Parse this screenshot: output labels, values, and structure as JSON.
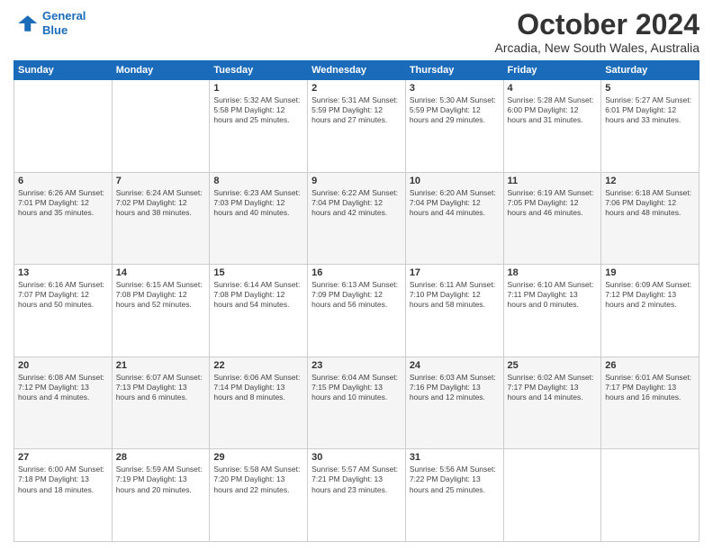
{
  "header": {
    "logo_line1": "General",
    "logo_line2": "Blue",
    "title": "October 2024",
    "subtitle": "Arcadia, New South Wales, Australia"
  },
  "days_of_week": [
    "Sunday",
    "Monday",
    "Tuesday",
    "Wednesday",
    "Thursday",
    "Friday",
    "Saturday"
  ],
  "weeks": [
    [
      {
        "day": "",
        "content": ""
      },
      {
        "day": "",
        "content": ""
      },
      {
        "day": "1",
        "content": "Sunrise: 5:32 AM\nSunset: 5:58 PM\nDaylight: 12 hours\nand 25 minutes."
      },
      {
        "day": "2",
        "content": "Sunrise: 5:31 AM\nSunset: 5:59 PM\nDaylight: 12 hours\nand 27 minutes."
      },
      {
        "day": "3",
        "content": "Sunrise: 5:30 AM\nSunset: 5:59 PM\nDaylight: 12 hours\nand 29 minutes."
      },
      {
        "day": "4",
        "content": "Sunrise: 5:28 AM\nSunset: 6:00 PM\nDaylight: 12 hours\nand 31 minutes."
      },
      {
        "day": "5",
        "content": "Sunrise: 5:27 AM\nSunset: 6:01 PM\nDaylight: 12 hours\nand 33 minutes."
      }
    ],
    [
      {
        "day": "6",
        "content": "Sunrise: 6:26 AM\nSunset: 7:01 PM\nDaylight: 12 hours\nand 35 minutes."
      },
      {
        "day": "7",
        "content": "Sunrise: 6:24 AM\nSunset: 7:02 PM\nDaylight: 12 hours\nand 38 minutes."
      },
      {
        "day": "8",
        "content": "Sunrise: 6:23 AM\nSunset: 7:03 PM\nDaylight: 12 hours\nand 40 minutes."
      },
      {
        "day": "9",
        "content": "Sunrise: 6:22 AM\nSunset: 7:04 PM\nDaylight: 12 hours\nand 42 minutes."
      },
      {
        "day": "10",
        "content": "Sunrise: 6:20 AM\nSunset: 7:04 PM\nDaylight: 12 hours\nand 44 minutes."
      },
      {
        "day": "11",
        "content": "Sunrise: 6:19 AM\nSunset: 7:05 PM\nDaylight: 12 hours\nand 46 minutes."
      },
      {
        "day": "12",
        "content": "Sunrise: 6:18 AM\nSunset: 7:06 PM\nDaylight: 12 hours\nand 48 minutes."
      }
    ],
    [
      {
        "day": "13",
        "content": "Sunrise: 6:16 AM\nSunset: 7:07 PM\nDaylight: 12 hours\nand 50 minutes."
      },
      {
        "day": "14",
        "content": "Sunrise: 6:15 AM\nSunset: 7:08 PM\nDaylight: 12 hours\nand 52 minutes."
      },
      {
        "day": "15",
        "content": "Sunrise: 6:14 AM\nSunset: 7:08 PM\nDaylight: 12 hours\nand 54 minutes."
      },
      {
        "day": "16",
        "content": "Sunrise: 6:13 AM\nSunset: 7:09 PM\nDaylight: 12 hours\nand 56 minutes."
      },
      {
        "day": "17",
        "content": "Sunrise: 6:11 AM\nSunset: 7:10 PM\nDaylight: 12 hours\nand 58 minutes."
      },
      {
        "day": "18",
        "content": "Sunrise: 6:10 AM\nSunset: 7:11 PM\nDaylight: 13 hours\nand 0 minutes."
      },
      {
        "day": "19",
        "content": "Sunrise: 6:09 AM\nSunset: 7:12 PM\nDaylight: 13 hours\nand 2 minutes."
      }
    ],
    [
      {
        "day": "20",
        "content": "Sunrise: 6:08 AM\nSunset: 7:12 PM\nDaylight: 13 hours\nand 4 minutes."
      },
      {
        "day": "21",
        "content": "Sunrise: 6:07 AM\nSunset: 7:13 PM\nDaylight: 13 hours\nand 6 minutes."
      },
      {
        "day": "22",
        "content": "Sunrise: 6:06 AM\nSunset: 7:14 PM\nDaylight: 13 hours\nand 8 minutes."
      },
      {
        "day": "23",
        "content": "Sunrise: 6:04 AM\nSunset: 7:15 PM\nDaylight: 13 hours\nand 10 minutes."
      },
      {
        "day": "24",
        "content": "Sunrise: 6:03 AM\nSunset: 7:16 PM\nDaylight: 13 hours\nand 12 minutes."
      },
      {
        "day": "25",
        "content": "Sunrise: 6:02 AM\nSunset: 7:17 PM\nDaylight: 13 hours\nand 14 minutes."
      },
      {
        "day": "26",
        "content": "Sunrise: 6:01 AM\nSunset: 7:17 PM\nDaylight: 13 hours\nand 16 minutes."
      }
    ],
    [
      {
        "day": "27",
        "content": "Sunrise: 6:00 AM\nSunset: 7:18 PM\nDaylight: 13 hours\nand 18 minutes."
      },
      {
        "day": "28",
        "content": "Sunrise: 5:59 AM\nSunset: 7:19 PM\nDaylight: 13 hours\nand 20 minutes."
      },
      {
        "day": "29",
        "content": "Sunrise: 5:58 AM\nSunset: 7:20 PM\nDaylight: 13 hours\nand 22 minutes."
      },
      {
        "day": "30",
        "content": "Sunrise: 5:57 AM\nSunset: 7:21 PM\nDaylight: 13 hours\nand 23 minutes."
      },
      {
        "day": "31",
        "content": "Sunrise: 5:56 AM\nSunset: 7:22 PM\nDaylight: 13 hours\nand 25 minutes."
      },
      {
        "day": "",
        "content": ""
      },
      {
        "day": "",
        "content": ""
      }
    ]
  ]
}
